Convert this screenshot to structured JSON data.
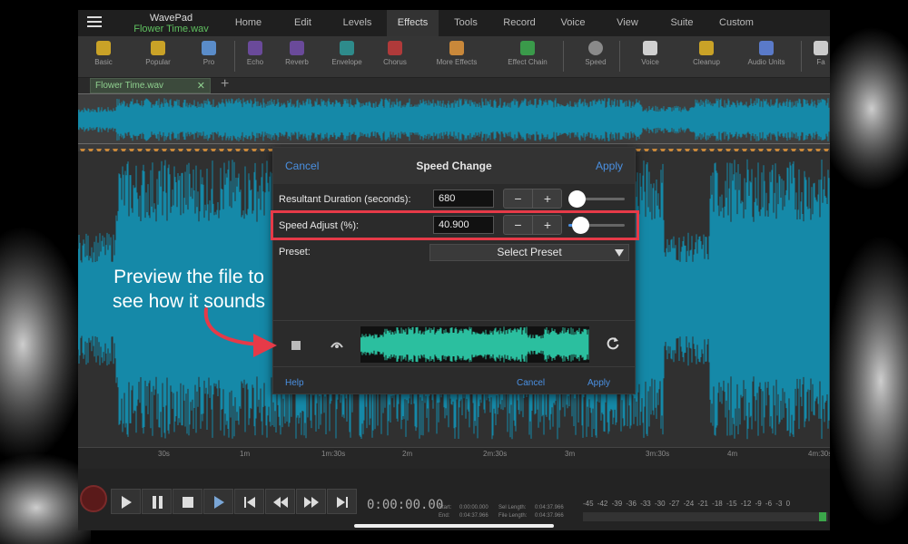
{
  "app": {
    "name": "WavePad",
    "file": "Flower Time.wav"
  },
  "menu": [
    "Home",
    "Edit",
    "Levels",
    "Effects",
    "Tools",
    "Record",
    "Voice",
    "View",
    "Suite",
    "Custom"
  ],
  "menu_active": "Effects",
  "ribbon": {
    "basic": "Basic",
    "popular": "Popular",
    "pro": "Pro",
    "echo": "Echo",
    "reverb": "Reverb",
    "envelope": "Envelope",
    "chorus": "Chorus",
    "more_effects": "More Effects",
    "effect_chain": "Effect Chain",
    "speed": "Speed",
    "voice": "Voice",
    "cleanup": "Cleanup",
    "audio_units": "Audio Units",
    "fa": "Fa"
  },
  "file_tab": {
    "label": "Flower Time.wav",
    "close": "✕",
    "add": "+"
  },
  "timeline": [
    "30s",
    "1m",
    "1m:30s",
    "2m",
    "2m:30s",
    "3m",
    "3m:30s",
    "4m",
    "4m:30s"
  ],
  "transport": {
    "timecode": "0:00:00.00",
    "start_label": "Start:",
    "start": "0:00:00.000",
    "end_label": "End:",
    "end": "0:04:37.966",
    "sel_length_label": "Sel Length:",
    "sel_length": "0:04:37.966",
    "file_length_label": "File Length:",
    "file_length": "0:04:37.966"
  },
  "meter_scale": [
    "-45",
    "-42",
    "-39",
    "-36",
    "-33",
    "-30",
    "-27",
    "-24",
    "-21",
    "-18",
    "-15",
    "-12",
    "-9",
    "-6",
    "-3",
    "0"
  ],
  "dialog": {
    "title": "Speed Change",
    "cancel": "Cancel",
    "apply": "Apply",
    "duration_label": "Resultant Duration (seconds):",
    "duration_value": "680",
    "duration_slider_fraction": 0.14,
    "speed_label": "Speed Adjust (%):",
    "speed_value": "40.900",
    "speed_slider_fraction": 0.21,
    "minus": "−",
    "plus": "+",
    "preset_label": "Preset:",
    "preset_value": "Select Preset",
    "help": "Help",
    "cancel_bottom": "Cancel",
    "apply_bottom": "Apply"
  },
  "annotation": "Preview the file to see how it sounds",
  "colors": {
    "accent": "#4a90e2",
    "waveform": "#1589a8",
    "preview_wave": "#2bbf9f",
    "highlight": "#e63a48",
    "arrow": "#e63a48",
    "file_green": "#5fc05f"
  }
}
